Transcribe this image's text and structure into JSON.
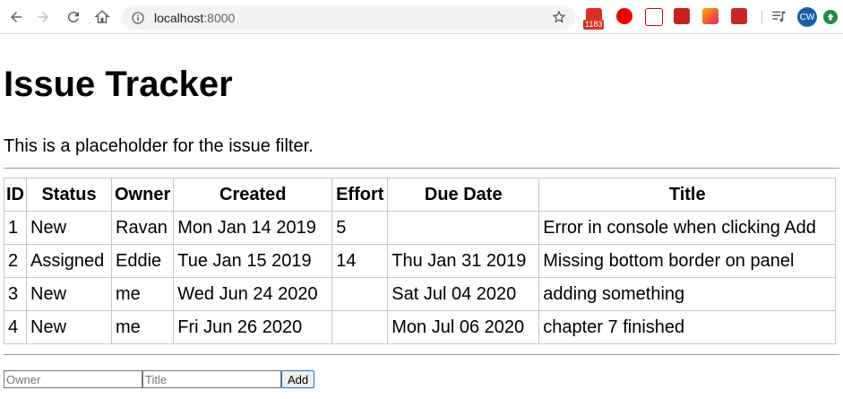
{
  "browser": {
    "url_host": "localhost",
    "url_port": ":8000",
    "ext_badge": "1183",
    "avatar_initials": "CW"
  },
  "page": {
    "title": "Issue Tracker",
    "filter_text": "This is a placeholder for the issue filter."
  },
  "table": {
    "headers": [
      "ID",
      "Status",
      "Owner",
      "Created",
      "Effort",
      "Due Date",
      "Title"
    ],
    "rows": [
      [
        "1",
        "New",
        "Ravan",
        "Mon Jan 14 2019",
        "5",
        "",
        "Error in console when clicking Add"
      ],
      [
        "2",
        "Assigned",
        "Eddie",
        "Tue Jan 15 2019",
        "14",
        "Thu Jan 31 2019",
        "Missing bottom border on panel"
      ],
      [
        "3",
        "New",
        "me",
        "Wed Jun 24 2020",
        "",
        "Sat Jul 04 2020",
        "adding something"
      ],
      [
        "4",
        "New",
        "me",
        "Fri Jun 26 2020",
        "",
        "Mon Jul 06 2020",
        "chapter 7 finished"
      ]
    ]
  },
  "form": {
    "owner_placeholder": "Owner",
    "title_placeholder": "Title",
    "add_label": "Add"
  }
}
